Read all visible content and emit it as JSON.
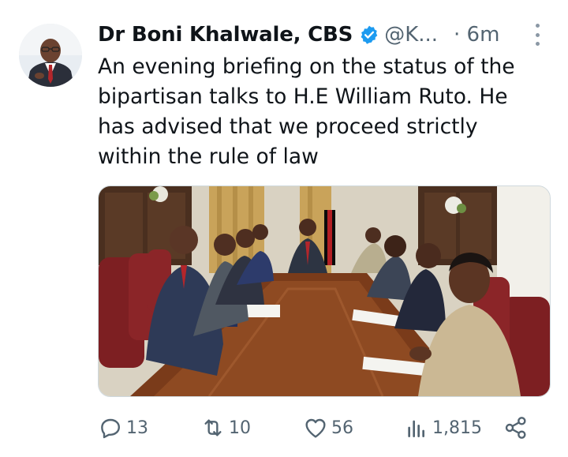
{
  "author": {
    "name": "Dr Boni Khalwale, CBS",
    "handle": "@K...",
    "time": "· 6m",
    "avatar_icon": "profile-photo",
    "verified_color": "#1d9bf0"
  },
  "tweet": {
    "lines": [
      "An evening briefing on the status of the",
      "bipartisan talks to H.E William Ruto. He",
      "has advised that we proceed strictly",
      "within the rule of law"
    ]
  },
  "media": {
    "kind": "photo",
    "icon": "meeting-photo"
  },
  "actions": {
    "replies": "13",
    "retweets": "10",
    "likes": "56",
    "views": "1,815",
    "reply_icon": "reply-icon",
    "retweet_icon": "retweet-icon",
    "like_icon": "heart-icon",
    "views_icon": "views-chart-icon",
    "share_icon": "share-icon"
  }
}
